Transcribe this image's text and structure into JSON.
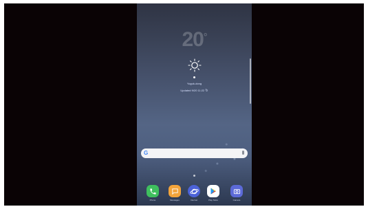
{
  "weather": {
    "temperature": "20",
    "degree_symbol": "°",
    "location": "Yoguk-dong",
    "updated": "Updated 9/20 11:22"
  },
  "search": {
    "placeholder": ""
  },
  "dock": {
    "apps": [
      {
        "label": "Phone",
        "icon": "phone-icon",
        "color": "#3fbf5e"
      },
      {
        "label": "Messages",
        "icon": "messages-icon",
        "color": "#f3a43b"
      },
      {
        "label": "Internet",
        "icon": "internet-icon",
        "color": "#4c62d8"
      },
      {
        "label": "Play Store",
        "icon": "play-store-icon",
        "color": "#ffffff"
      },
      {
        "label": "Camera",
        "icon": "camera-icon",
        "color": "#5c6ad8"
      }
    ]
  },
  "colors": {
    "frame": "#0a0305",
    "wallpaper_top": "#2f3444",
    "wallpaper_mid": "#546585",
    "search_bar": "#f4f4f6"
  }
}
